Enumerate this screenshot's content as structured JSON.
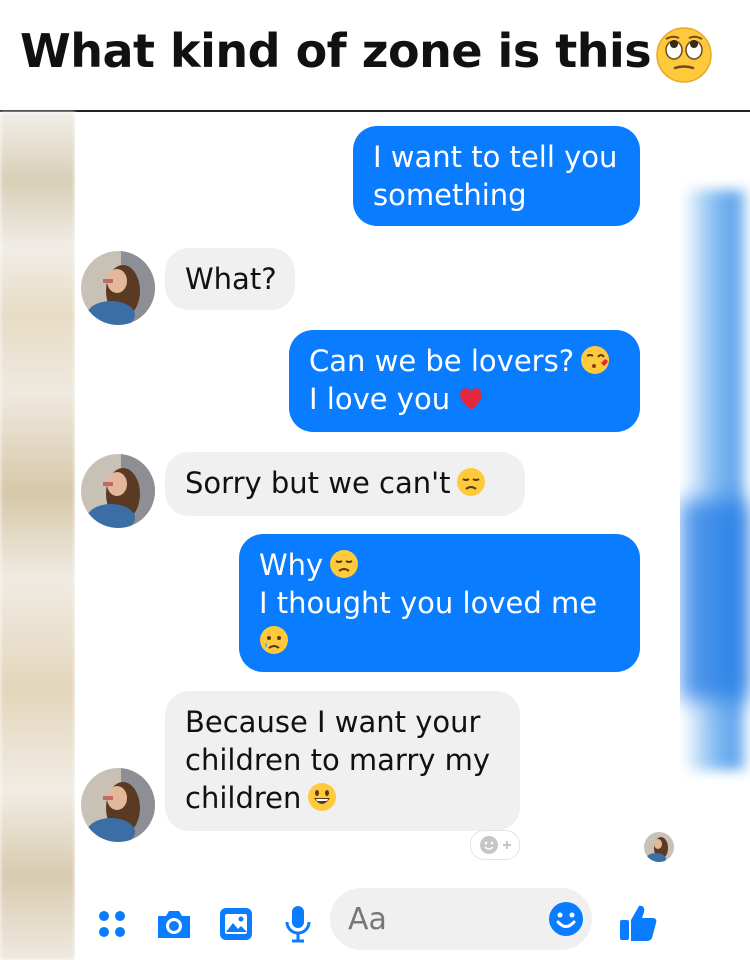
{
  "header": {
    "title": "What kind of zone is this",
    "emoji": "eye-roll-emoji"
  },
  "colors": {
    "accent": "#0a7cff",
    "incoming_bubble": "#f0f0f0",
    "outgoing_text": "#ffffff"
  },
  "messages": [
    {
      "direction": "out",
      "lines": [
        "I want to tell you",
        "something"
      ]
    },
    {
      "direction": "in",
      "lines": [
        "What?"
      ]
    },
    {
      "direction": "out",
      "lines": [
        "Can we be lovers?",
        "I love you"
      ],
      "emojis": [
        "kissing-heart-emoji",
        "red-heart-emoji"
      ]
    },
    {
      "direction": "in",
      "lines": [
        "Sorry but we can't"
      ],
      "emojis": [
        "disappointed-emoji"
      ]
    },
    {
      "direction": "out",
      "lines": [
        "Why",
        "I thought you loved me"
      ],
      "emojis": [
        "disappointed-emoji",
        "crying-face-emoji"
      ]
    },
    {
      "direction": "in",
      "lines": [
        "Because I want your",
        "children to marry my",
        "children"
      ],
      "emojis": [
        "grinning-emoji"
      ]
    }
  ],
  "composer": {
    "placeholder": "Aa"
  },
  "toolbar": {
    "icons": [
      "more-dots-icon",
      "camera-icon",
      "gallery-icon",
      "microphone-icon",
      "emoji-icon",
      "thumbs-up-icon"
    ]
  }
}
